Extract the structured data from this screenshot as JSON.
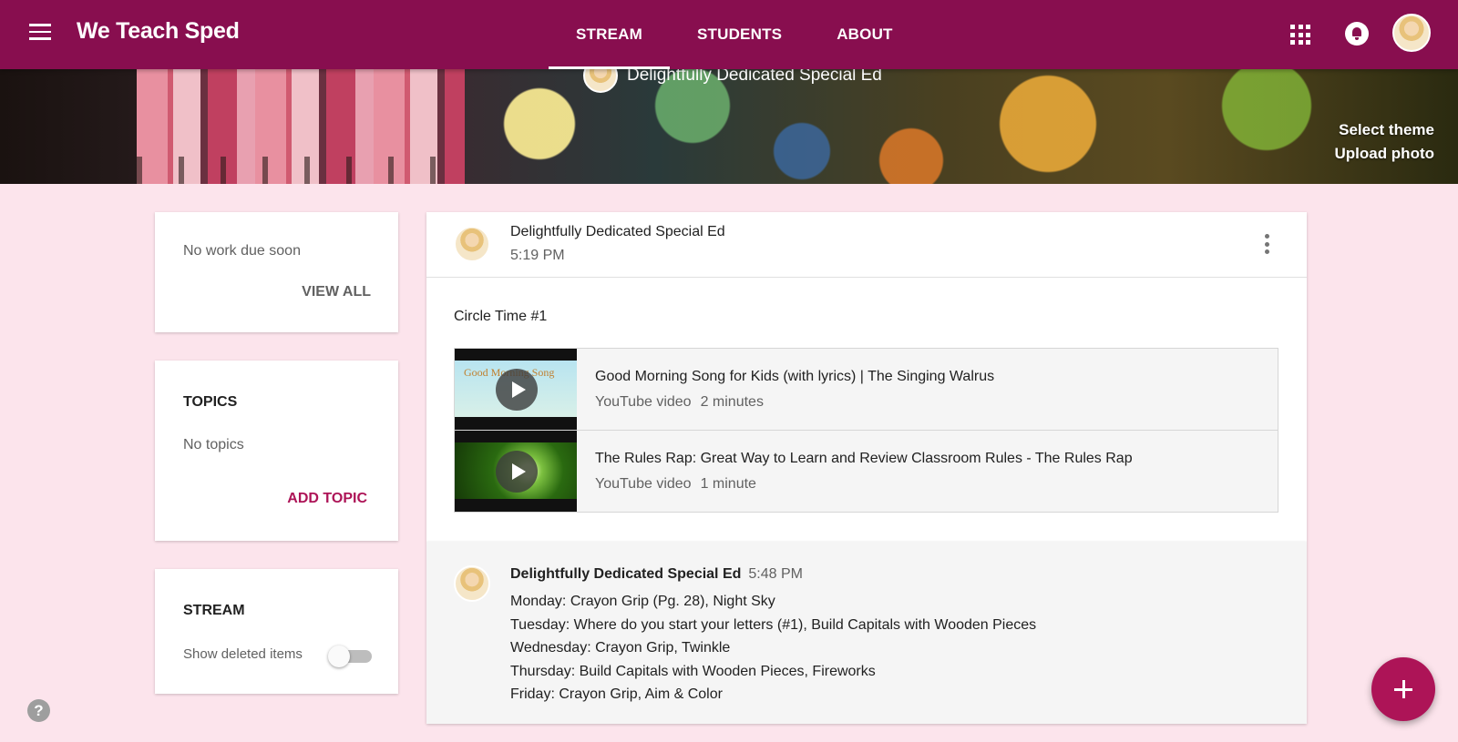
{
  "app": {
    "title": "We Teach Sped"
  },
  "tabs": [
    {
      "label": "STREAM",
      "active": true
    },
    {
      "label": "STUDENTS",
      "active": false
    },
    {
      "label": "ABOUT",
      "active": false
    }
  ],
  "icons": {
    "menu": "menu-icon",
    "apps": "apps-grid-icon",
    "notifications": "bell-icon",
    "more": "more-vert-icon",
    "play": "play-icon",
    "help": "help-icon",
    "add": "plus-icon"
  },
  "colors": {
    "brand": "#880e4f",
    "accent": "#ad1457",
    "page_background": "#fce4ec"
  },
  "banner": {
    "partial_text": "Delightfully Dedicated Special Ed",
    "select_theme": "Select theme",
    "upload_photo": "Upload photo"
  },
  "upcoming": {
    "text": "No work due soon",
    "view_all": "VIEW ALL"
  },
  "topics": {
    "heading": "TOPICS",
    "empty_text": "No topics",
    "add_label": "ADD TOPIC"
  },
  "stream_settings": {
    "heading": "STREAM",
    "show_deleted_label": "Show deleted items",
    "show_deleted_on": false
  },
  "post": {
    "author": "Delightfully Dedicated Special Ed",
    "time": "5:19 PM",
    "text": "Circle Time #1",
    "attachments": [
      {
        "title": "Good Morning Song for Kids (with lyrics) | The Singing Walrus",
        "type": "YouTube video",
        "duration": "2 minutes"
      },
      {
        "title": "The Rules Rap: Great Way to Learn and Review Classroom Rules - The Rules Rap",
        "type": "YouTube video",
        "duration": "1 minute"
      }
    ]
  },
  "post2": {
    "author": "Delightfully Dedicated Special Ed",
    "time": "5:48 PM",
    "lines": [
      "Monday: Crayon Grip (Pg. 28), Night Sky",
      "Tuesday: Where do you start your letters (#1), Build Capitals with Wooden Pieces",
      "Wednesday: Crayon Grip, Twinkle",
      "Thursday: Build Capitals with Wooden Pieces, Fireworks",
      "Friday: Crayon Grip, Aim & Color"
    ]
  },
  "help": {
    "glyph": "?"
  }
}
